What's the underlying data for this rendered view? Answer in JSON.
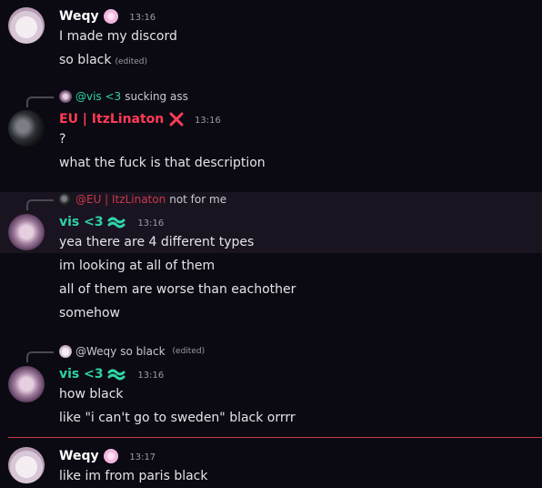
{
  "messages": [
    {
      "author": "Weqy",
      "author_color": "#ffffff",
      "badge_icon": "flower-badge-icon",
      "time": "13:16",
      "lines": [
        "I made my discord",
        "so black"
      ],
      "edited_label": "(edited)"
    },
    {
      "reply_to": {
        "author": "@vis <3",
        "author_color": "#2ed3a6",
        "text": "sucking ass"
      },
      "author": "EU | ItzLinaton",
      "author_color": "#ff3b55",
      "badge_icon": "crossed-tools-icon",
      "time": "13:16",
      "lines": [
        "?",
        "what the fuck is that description"
      ]
    },
    {
      "reply_to": {
        "author": "@EU | ItzLinaton",
        "author_color": "#ff3b55",
        "text": "not for me"
      },
      "author": "vis <3",
      "author_color": "#2ed3a6",
      "badge_icon": "wave-badge-icon",
      "time": "13:16",
      "lines": [
        "yea there are 4 different types",
        "im looking at all of them",
        "all of them are worse than eachother",
        "somehow"
      ]
    },
    {
      "reply_to": {
        "author": "@Weqy",
        "author_color": "#c8c9cf",
        "text": "so black",
        "edited_label": "(edited)"
      },
      "author": "vis <3",
      "author_color": "#2ed3a6",
      "badge_icon": "wave-badge-icon",
      "time": "13:16",
      "lines": [
        "how black",
        "like \"i can't go to sweden\" black orrrr"
      ]
    },
    {
      "author": "Weqy",
      "author_color": "#ffffff",
      "badge_icon": "flower-badge-icon",
      "time": "13:17",
      "lines": [
        "like im from paris black"
      ]
    }
  ]
}
